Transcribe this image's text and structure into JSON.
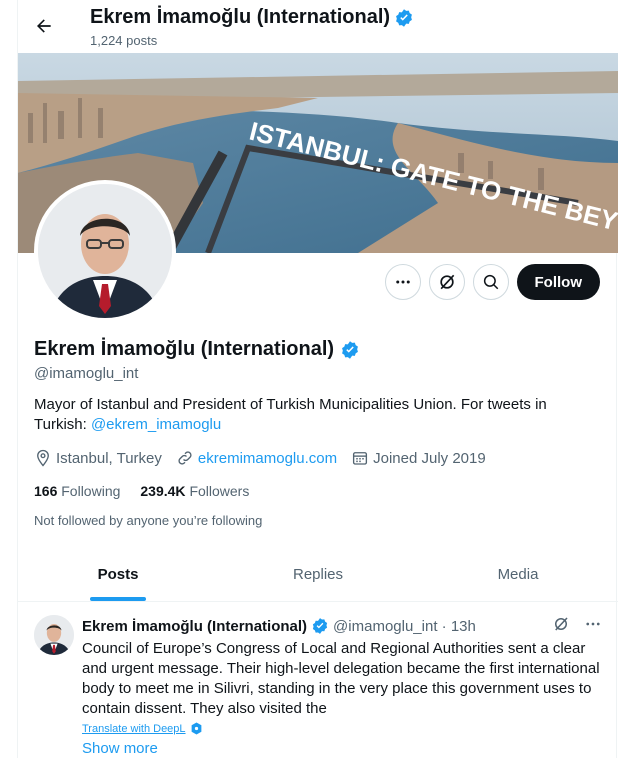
{
  "header": {
    "title": "Ekrem İmamoğlu (International)",
    "posts_count": "1,224 posts",
    "back_icon": "arrow-left-icon"
  },
  "banner": {
    "text": "ISTANBUL: GATE TO THE BEYOND"
  },
  "actions": {
    "more_icon": "more-dots-icon",
    "grok_icon": "grok-slash-icon",
    "search_icon": "search-icon",
    "follow_label": "Follow"
  },
  "profile": {
    "name": "Ekrem İmamoğlu (International)",
    "handle": "@imamoglu_int",
    "bio_text": "Mayor of Istanbul and President of Turkish Municipalities Union. For tweets in Turkish: ",
    "bio_link": "@ekrem_imamoglu",
    "location": "Istanbul, Turkey",
    "website": "ekremimamoglu.com",
    "joined": "Joined July 2019",
    "following_count": "166",
    "following_label": "Following",
    "followers_count": "239.4K",
    "followers_label": "Followers",
    "not_followed": "Not followed by anyone you’re following",
    "verified_color": "#1d9bf0"
  },
  "tabs": [
    {
      "label": "Posts",
      "active": true
    },
    {
      "label": "Replies",
      "active": false
    },
    {
      "label": "Media",
      "active": false
    }
  ],
  "post": {
    "name": "Ekrem İmamoğlu (International)",
    "handle_time": "@imamoglu_int · 13h",
    "text": "Council of Europe’s Congress of Local and Regional Authorities sent a clear and urgent message. Their high-level delegation became the first international body to meet me in Silivri, standing in the very place this government uses to contain dissent. They also visited the",
    "translate": "Translate with DeepL",
    "show_more": "Show more"
  },
  "colors": {
    "accent": "#1d9bf0",
    "text": "#0f1419",
    "muted": "#536471"
  }
}
